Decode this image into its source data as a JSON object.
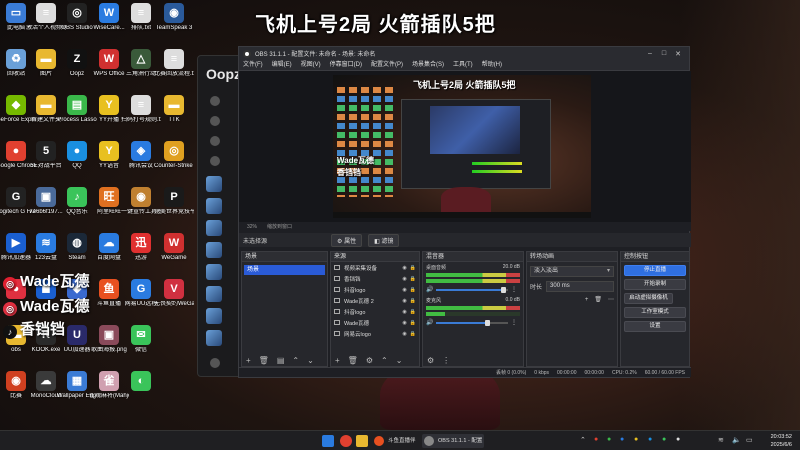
{
  "desktop": {
    "headline": "飞机上号2局 火箭插队5把",
    "icons_col1": [
      {
        "label": "此电脑",
        "icon": "computer-icon",
        "color": "#3a7bd5",
        "glyph": "▭"
      },
      {
        "label": "回收站",
        "icon": "recycle-bin-icon",
        "color": "#6aa0d8",
        "glyph": "♻"
      },
      {
        "label": "GeForce Experience",
        "icon": "geforce-icon",
        "color": "#76b900",
        "glyph": "◆"
      },
      {
        "label": "Google Chrome",
        "icon": "chrome-icon",
        "color": "#e04030",
        "glyph": "●"
      },
      {
        "label": "Logitech G HUB",
        "icon": "logitech-icon",
        "color": "#222",
        "glyph": "G"
      },
      {
        "label": "腾讯加速器",
        "icon": "accelerator-icon",
        "color": "#1a5fd0",
        "glyph": "▶"
      },
      {
        "label": "",
        "icon": "app-icon",
        "color": "#e03040",
        "glyph": "●"
      },
      {
        "label": "obs",
        "icon": "folder-icon",
        "color": "#e8b830",
        "glyph": "▬"
      },
      {
        "label": "比赛",
        "icon": "game-icon",
        "color": "#d04020",
        "glyph": "◉"
      }
    ],
    "icons_col2": [
      {
        "label": "激活个人视频号.txt",
        "icon": "text-file-icon",
        "color": "#ddd",
        "glyph": "≡"
      },
      {
        "label": "图片",
        "icon": "folder-icon",
        "color": "#e8b830",
        "glyph": "▬"
      },
      {
        "label": "新建文件夹",
        "icon": "folder-icon",
        "color": "#e8b830",
        "glyph": "▬"
      },
      {
        "label": "5E对战平台",
        "icon": "5e-icon",
        "color": "#222",
        "glyph": "5"
      },
      {
        "label": "7e6b6f197...",
        "icon": "image-icon",
        "color": "#4a6a9a",
        "glyph": "▣"
      },
      {
        "label": "123云盘",
        "icon": "cloud-icon",
        "color": "#2a7be0",
        "glyph": "≋"
      },
      {
        "label": "",
        "icon": "app-icon",
        "color": "#1a5fd0",
        "glyph": "◼"
      },
      {
        "label": "KOOK.exe",
        "icon": "kook-icon",
        "color": "#2a2a2a",
        "glyph": "K"
      },
      {
        "label": "MonoCloud",
        "icon": "monocloud-icon",
        "color": "#3a3a3a",
        "glyph": "☁"
      }
    ],
    "icons_col3": [
      {
        "label": "OBS Studio",
        "icon": "obs-icon",
        "color": "#222",
        "glyph": "◎"
      },
      {
        "label": "Oopz",
        "icon": "oopz-icon",
        "color": "#111",
        "glyph": "Z"
      },
      {
        "label": "Process Lasso",
        "icon": "process-lasso-icon",
        "color": "#3ab84a",
        "glyph": "▤"
      },
      {
        "label": "QQ",
        "icon": "qq-icon",
        "color": "#1a8fe0",
        "glyph": "●"
      },
      {
        "label": "QQ音乐",
        "icon": "qq-music-icon",
        "color": "#3ac45a",
        "glyph": "♪"
      },
      {
        "label": "Steam",
        "icon": "steam-icon",
        "color": "#1b2838",
        "glyph": "◍"
      },
      {
        "label": "",
        "icon": "app-icon",
        "color": "#3a6ad0",
        "glyph": "◆"
      },
      {
        "label": "UU加速器",
        "icon": "uu-icon",
        "color": "#2a2a6a",
        "glyph": "U"
      },
      {
        "label": "Wallpaper Engine: ...",
        "icon": "wallpaper-engine-icon",
        "color": "#3a7bd5",
        "glyph": "▦"
      }
    ],
    "icons_col4": [
      {
        "label": "WiseCare...",
        "icon": "wisecare-icon",
        "color": "#2a7be0",
        "glyph": "W"
      },
      {
        "label": "WPS Office",
        "icon": "wps-icon",
        "color": "#d03030",
        "glyph": "W"
      },
      {
        "label": "YY开播",
        "icon": "yy-icon",
        "color": "#e8c020",
        "glyph": "Y"
      },
      {
        "label": "YY语音",
        "icon": "yy-voice-icon",
        "color": "#e8c020",
        "glyph": "Y"
      },
      {
        "label": "阿里旺旺",
        "icon": "wangwang-icon",
        "color": "#e07020",
        "glyph": "旺"
      },
      {
        "label": "百度网盘",
        "icon": "baidu-pan-icon",
        "color": "#2a7be0",
        "glyph": "☁"
      },
      {
        "label": "斗鱼直播",
        "icon": "douyu-icon",
        "color": "#e85020",
        "glyph": "鱼"
      },
      {
        "label": "歌曲海报.png",
        "icon": "image-icon",
        "color": "#8a4a5a",
        "glyph": "▣"
      },
      {
        "label": "雀魂麻将(Mahjong...",
        "icon": "mahjong-icon",
        "color": "#d0a0b0",
        "glyph": "雀"
      }
    ],
    "icons_col5": [
      {
        "label": "排队.txt",
        "icon": "text-file-icon",
        "color": "#ddd",
        "glyph": "≡"
      },
      {
        "label": "三角洲行动",
        "icon": "delta-force-icon",
        "color": "#3a5a3a",
        "glyph": "△"
      },
      {
        "label": "扫码打号规则.txt",
        "icon": "text-file-icon",
        "color": "#ddd",
        "glyph": "≡"
      },
      {
        "label": "腾讯会议",
        "icon": "meeting-icon",
        "color": "#2a7be0",
        "glyph": "◈"
      },
      {
        "label": "一键宣传工具器2025 - 快...",
        "icon": "tool-icon",
        "color": "#c08030",
        "glyph": "◉"
      },
      {
        "label": "迅游",
        "icon": "xunyou-icon",
        "color": "#e03030",
        "glyph": "迅"
      },
      {
        "label": "网易UU远程",
        "icon": "uu-remote-icon",
        "color": "#2a7be0",
        "glyph": "G"
      },
      {
        "label": "微信",
        "icon": "wechat-icon",
        "color": "#3ac45a",
        "glyph": "✉"
      },
      {
        "label": "",
        "icon": "app-icon",
        "color": "#3ac45a",
        "glyph": "◐"
      }
    ],
    "icons_col6": [
      {
        "label": "TeamSpeak 3",
        "icon": "teamspeak-icon",
        "color": "#2a5a9a",
        "glyph": "◉"
      },
      {
        "label": "比赛回放流程.txt",
        "icon": "text-file-icon",
        "color": "#ddd",
        "glyph": "≡"
      },
      {
        "label": "TTK",
        "icon": "folder-icon",
        "color": "#e8b830",
        "glyph": "▬"
      },
      {
        "label": "Counter-Strike 2",
        "icon": "cs2-icon",
        "color": "#e0a020",
        "glyph": "◎"
      },
      {
        "label": "完美世界竞技平台",
        "icon": "perfect-world-icon",
        "color": "#1a1a1a",
        "glyph": "P"
      },
      {
        "label": "WeGame",
        "icon": "wegame-icon",
        "color": "#d03030",
        "glyph": "W"
      },
      {
        "label": "无畏契约WeGame版",
        "icon": "valorant-icon",
        "color": "#d03040",
        "glyph": "V"
      }
    ],
    "overlay": [
      "Wade瓦德",
      "Wade瓦德",
      "香铛铛"
    ]
  },
  "oopz": {
    "logo": "Oopz"
  },
  "obs": {
    "title": "OBS 31.1.1 - 配置文件: 未命名 - 场景: 未命名",
    "menu": [
      "文件(F)",
      "编辑(E)",
      "视图(V)",
      "停靠窗口(D)",
      "配置文件(P)",
      "场景集合(S)",
      "工具(T)",
      "帮助(H)"
    ],
    "preview_title": "飞机上号2局 火箭插队5把",
    "preview_overlay": [
      "Wade瓦德",
      "香铛铛"
    ],
    "zoom": "32%",
    "zoom_mode": "缩放到窗口",
    "no_source": "未选择源",
    "properties_btn": "属性",
    "filters_btn": "滤镜",
    "scenes": {
      "header": "场景",
      "items": [
        "场景"
      ]
    },
    "sources": {
      "header": "来源",
      "items": [
        "视频采集设备",
        "香铛铛",
        "抖音logo",
        "Wade瓦德 2",
        "抖音logo",
        "Wade瓦德",
        "网易云logo"
      ]
    },
    "mixer": {
      "header": "混音器",
      "channels": [
        {
          "name": "桌面音频",
          "db": "20.0 dB"
        },
        {
          "name": "麦克风",
          "db": "0.0 dB"
        }
      ]
    },
    "transitions": {
      "header": "转场动画",
      "type": "淡入淡出",
      "duration_label": "时长",
      "duration": "300 ms"
    },
    "controls": {
      "header": "控制按钮",
      "buttons": [
        "停止直播",
        "开始录制",
        "启动虚拟摄像机",
        "工作室模式",
        "设置"
      ]
    },
    "status": {
      "frames": "丢帧 0 (0.0%)",
      "bitrate": "0 kbps",
      "time1": "00:00:00",
      "time2": "00:00:00",
      "cpu": "CPU: 0.2%",
      "fps": "60.00 / 60.00 FPS"
    }
  },
  "taskbar": {
    "tasks": [
      {
        "label": "斗鱼直播伴侣",
        "color": "#e85020"
      },
      {
        "label": "OBS 31.1.1 - 配置文件: 未",
        "color": "#888"
      }
    ],
    "time": "20:03:52",
    "date": "2025/6/6"
  }
}
